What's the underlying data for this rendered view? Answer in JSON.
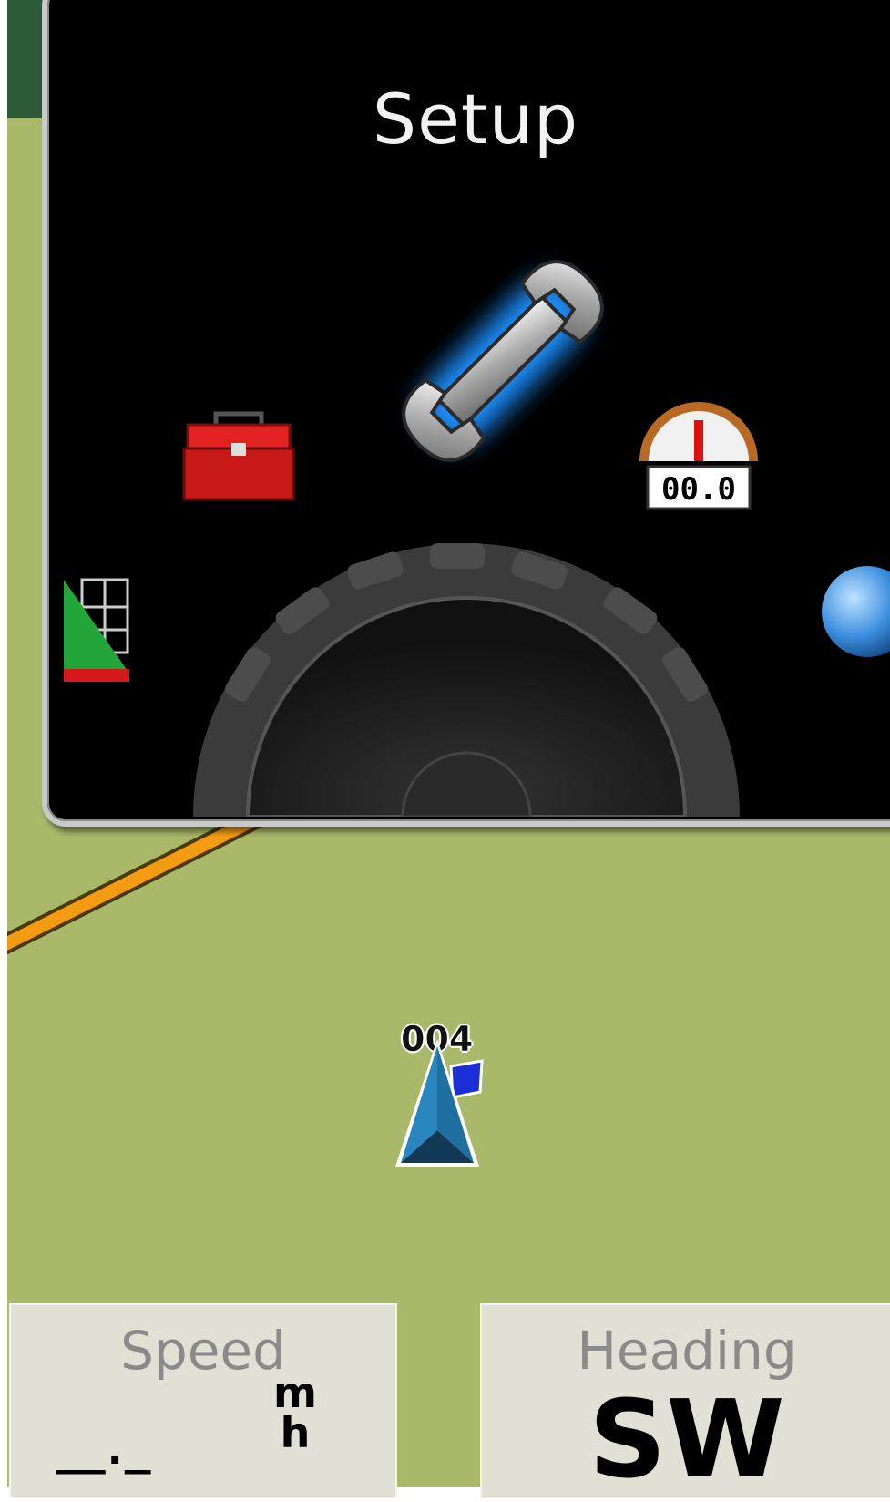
{
  "menu": {
    "title": "Setup",
    "items": [
      {
        "id": "setup",
        "icon": "wrench-icon",
        "selected": true
      },
      {
        "id": "tools",
        "icon": "toolbox-icon"
      },
      {
        "id": "trip-computer",
        "icon": "gauge-icon",
        "text": "00.0"
      },
      {
        "id": "profile",
        "icon": "elevation-grid-icon"
      },
      {
        "id": "globe",
        "icon": "globe-icon"
      }
    ]
  },
  "map": {
    "waypoint_label": "004",
    "background_color": "#a9b869",
    "road_color": "#f39c12"
  },
  "data_fields": {
    "speed": {
      "label": "Speed",
      "value": "__._",
      "unit_top": "m",
      "unit_bottom": "h"
    },
    "heading": {
      "label": "Heading",
      "value": "SW"
    }
  },
  "colors": {
    "selection_glow": "#1e90ff",
    "panel_bg": "#000000",
    "field_bg": "#e0e0d5"
  }
}
